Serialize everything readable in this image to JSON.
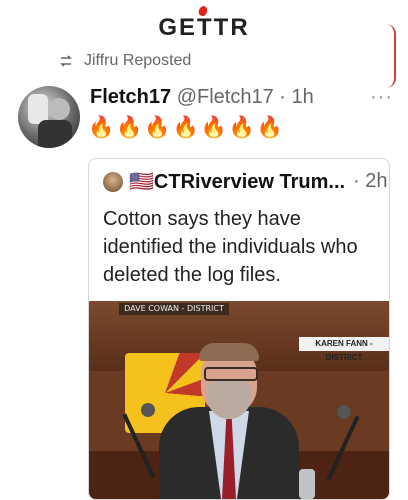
{
  "app": {
    "logo": "GETTR"
  },
  "repost": {
    "label": "Jiffru Reposted"
  },
  "post": {
    "author": "Fletch17",
    "handle": "@Fletch17",
    "dot": "·",
    "time": "1h",
    "more": "···",
    "emojis": "🔥🔥🔥🔥🔥🔥🔥"
  },
  "quoted": {
    "author": "🇺🇸CTRiverview Trum...",
    "dot": "·",
    "time": "2h",
    "text": "Cotton says they have identified the individuals who deleted the log files.",
    "image": {
      "sign_top": "DAVE COWAN - DISTRICT",
      "sign_name": "KAREN FANN - DISTRICT"
    }
  }
}
